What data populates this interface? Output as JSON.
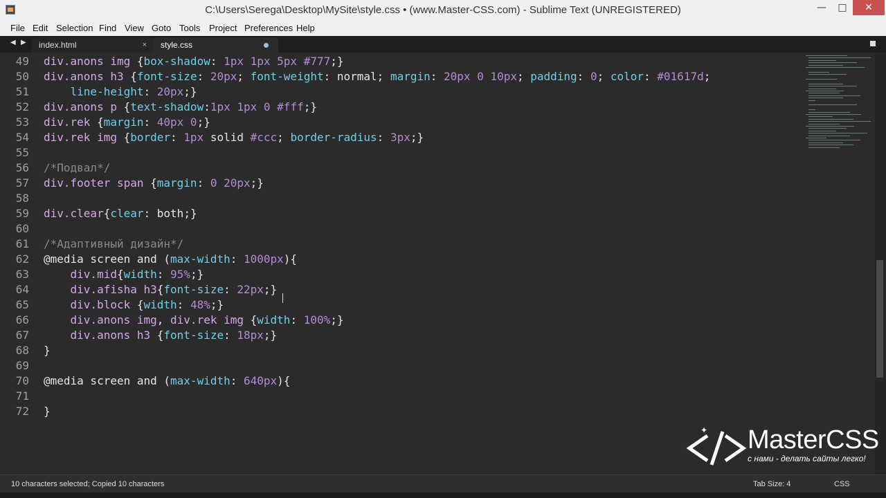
{
  "window": {
    "title": "C:\\Users\\Serega\\Desktop\\MySite\\style.css • (www.Master-CSS.com) - Sublime Text (UNREGISTERED)",
    "min_glyph": "—",
    "max_glyph": "□",
    "close_glyph": "✕"
  },
  "menu": [
    "File",
    "Edit",
    "Selection",
    "Find",
    "View",
    "Goto",
    "Tools",
    "Project",
    "Preferences",
    "Help"
  ],
  "tabs": {
    "nav_left": "◀",
    "nav_right": "▶",
    "items": [
      {
        "label": "index.html",
        "close": "×"
      },
      {
        "label": "style.css"
      }
    ]
  },
  "editor": {
    "lines": [
      {
        "n": "49"
      },
      {
        "n": "50"
      },
      {
        "n": "51"
      },
      {
        "n": "52"
      },
      {
        "n": "53"
      },
      {
        "n": "54"
      },
      {
        "n": "55"
      },
      {
        "n": "56"
      },
      {
        "n": "57"
      },
      {
        "n": "58"
      },
      {
        "n": "59"
      },
      {
        "n": "60"
      },
      {
        "n": "61"
      },
      {
        "n": "62"
      },
      {
        "n": "63"
      },
      {
        "n": "64"
      },
      {
        "n": "65"
      },
      {
        "n": "66"
      },
      {
        "n": "67"
      },
      {
        "n": "68"
      },
      {
        "n": "69"
      },
      {
        "n": "70"
      },
      {
        "n": "71"
      },
      {
        "n": "72"
      }
    ],
    "code": {
      "l49": [
        [
          "sel",
          "div.anons img "
        ],
        [
          "kw",
          "{"
        ],
        [
          "prop",
          "box-shadow"
        ],
        [
          "kw",
          ": "
        ],
        [
          "num",
          "1px 1px 5px #777"
        ],
        [
          "kw",
          ";}"
        ]
      ],
      "l50": [
        [
          "sel",
          "div.anons h3 "
        ],
        [
          "kw",
          "{"
        ],
        [
          "prop",
          "font-size"
        ],
        [
          "kw",
          ": "
        ],
        [
          "num",
          "20px"
        ],
        [
          "kw",
          "; "
        ],
        [
          "prop",
          "font-weight"
        ],
        [
          "kw",
          ": normal; "
        ],
        [
          "prop",
          "margin"
        ],
        [
          "kw",
          ": "
        ],
        [
          "num",
          "20px 0 10px"
        ],
        [
          "kw",
          "; "
        ],
        [
          "prop",
          "padding"
        ],
        [
          "kw",
          ": "
        ],
        [
          "num",
          "0"
        ],
        [
          "kw",
          "; "
        ],
        [
          "prop",
          "color"
        ],
        [
          "kw",
          ": "
        ],
        [
          "num",
          "#01617d"
        ],
        [
          "kw",
          ";"
        ]
      ],
      "l51": [
        [
          "kw",
          "    "
        ],
        [
          "prop",
          "line-height"
        ],
        [
          "kw",
          ": "
        ],
        [
          "num",
          "20px"
        ],
        [
          "kw",
          ";}"
        ]
      ],
      "l52": [
        [
          "sel",
          "div.anons p "
        ],
        [
          "kw",
          "{"
        ],
        [
          "prop",
          "text-shadow"
        ],
        [
          "kw",
          ":"
        ],
        [
          "num",
          "1px 1px 0 #fff"
        ],
        [
          "kw",
          ";}"
        ]
      ],
      "l53": [
        [
          "sel",
          "div.rek "
        ],
        [
          "kw",
          "{"
        ],
        [
          "prop",
          "margin"
        ],
        [
          "kw",
          ": "
        ],
        [
          "num",
          "40px 0"
        ],
        [
          "kw",
          ";}"
        ]
      ],
      "l54": [
        [
          "sel",
          "div.rek img "
        ],
        [
          "kw",
          "{"
        ],
        [
          "prop",
          "border"
        ],
        [
          "kw",
          ": "
        ],
        [
          "num",
          "1px"
        ],
        [
          "kw",
          " solid "
        ],
        [
          "num",
          "#ccc"
        ],
        [
          "kw",
          "; "
        ],
        [
          "prop",
          "border-radius"
        ],
        [
          "kw",
          ": "
        ],
        [
          "num",
          "3px"
        ],
        [
          "kw",
          ";}"
        ]
      ],
      "l55": [],
      "l56": [
        [
          "cmt",
          "/*Подвал*/"
        ]
      ],
      "l57": [
        [
          "sel",
          "div.footer span "
        ],
        [
          "kw",
          "{"
        ],
        [
          "prop",
          "margin"
        ],
        [
          "kw",
          ": "
        ],
        [
          "num",
          "0 20px"
        ],
        [
          "kw",
          ";}"
        ]
      ],
      "l58": [],
      "l59": [
        [
          "sel",
          "div.clear"
        ],
        [
          "kw",
          "{"
        ],
        [
          "prop",
          "clear"
        ],
        [
          "kw",
          ": both;}"
        ]
      ],
      "l60": [],
      "l61": [
        [
          "cmt",
          "/*Адаптивный дизайн*/"
        ]
      ],
      "l62": [
        [
          "kw",
          "@media screen and ("
        ],
        [
          "prop",
          "max-width"
        ],
        [
          "kw",
          ": "
        ],
        [
          "num",
          "1000px"
        ],
        [
          "kw",
          "){"
        ]
      ],
      "l63": [
        [
          "kw",
          "    "
        ],
        [
          "sel",
          "div.mid"
        ],
        [
          "kw",
          "{"
        ],
        [
          "prop",
          "width"
        ],
        [
          "kw",
          ": "
        ],
        [
          "num",
          "95%"
        ],
        [
          "kw",
          ";}"
        ]
      ],
      "l64": [
        [
          "kw",
          "    "
        ],
        [
          "sel",
          "div.afisha h3"
        ],
        [
          "kw",
          "{"
        ],
        [
          "prop",
          "font-size"
        ],
        [
          "kw",
          ": "
        ],
        [
          "num",
          "22px"
        ],
        [
          "kw",
          ";}"
        ]
      ],
      "l65": [
        [
          "kw",
          "    "
        ],
        [
          "sel",
          "div.block "
        ],
        [
          "kw",
          "{"
        ],
        [
          "prop",
          "width"
        ],
        [
          "kw",
          ": "
        ],
        [
          "num",
          "48%"
        ],
        [
          "kw",
          ";}"
        ]
      ],
      "l66": [
        [
          "kw",
          "    "
        ],
        [
          "sel",
          "div.anons img"
        ],
        [
          "kw",
          ", "
        ],
        [
          "sel",
          "div.rek img "
        ],
        [
          "kw",
          "{"
        ],
        [
          "prop",
          "width"
        ],
        [
          "kw",
          ": "
        ],
        [
          "num",
          "100%"
        ],
        [
          "kw",
          ";}"
        ]
      ],
      "l67": [
        [
          "kw",
          "    "
        ],
        [
          "sel",
          "div.anons h3 "
        ],
        [
          "kw",
          "{"
        ],
        [
          "prop",
          "font-size"
        ],
        [
          "kw",
          ": "
        ],
        [
          "num",
          "18px"
        ],
        [
          "kw",
          ";}"
        ]
      ],
      "l68": [
        [
          "kw",
          "}"
        ]
      ],
      "l69": [],
      "l70": [
        [
          "kw",
          "@media screen and ("
        ],
        [
          "prop",
          "max-width"
        ],
        [
          "kw",
          ": "
        ],
        [
          "num",
          "640px"
        ],
        [
          "kw",
          "){"
        ]
      ],
      "l71": [],
      "l72": [
        [
          "kw",
          "}"
        ]
      ]
    }
  },
  "status": {
    "message": "10 characters selected; Copied 10 characters",
    "tab_size": "Tab Size: 4",
    "syntax": "CSS"
  },
  "watermark": {
    "brand_master": "Master",
    "brand_css": "CSS",
    "tagline": "с нами - делать сайты легко!"
  }
}
